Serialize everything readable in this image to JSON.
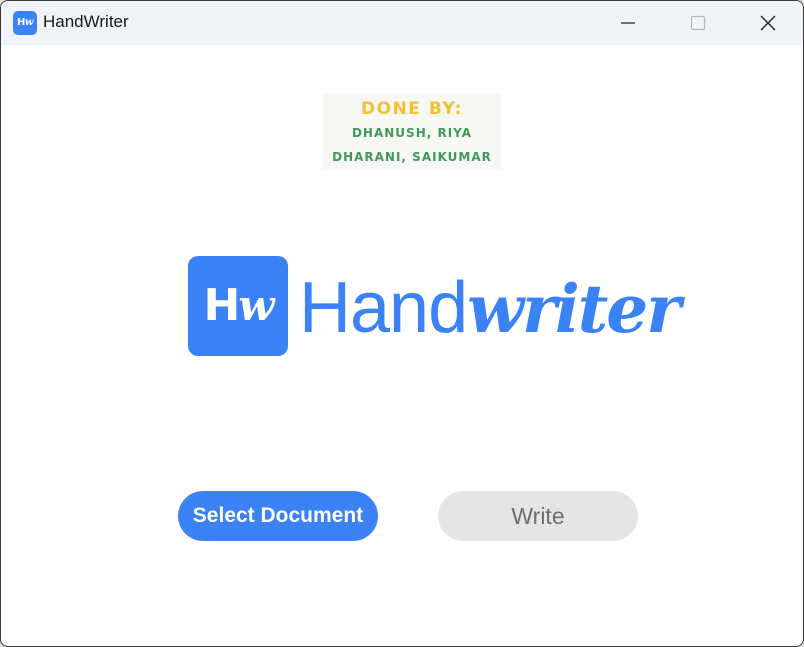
{
  "window": {
    "title": "HandWriter",
    "icon": {
      "name": "handwriter-app-icon",
      "text_main": "H",
      "text_italic": "w"
    }
  },
  "controls": {
    "minimize_icon": "minimize-icon",
    "maximize_icon": "maximize-icon",
    "close_icon": "close-icon"
  },
  "credits": {
    "heading": "DONE BY:",
    "line1": "DHANUSH, RIYA",
    "line2": "DHARANI, SAIKUMAR",
    "heading_color": "#f2c230",
    "names_color": "#3f9a5c"
  },
  "logo": {
    "mark_main": "H",
    "mark_italic": "w",
    "word_regular": "Hand",
    "word_italic": "writer",
    "brand_color": "#3b82f6"
  },
  "actions": {
    "select_label": "Select Document",
    "write_label": "Write",
    "write_enabled": false
  }
}
